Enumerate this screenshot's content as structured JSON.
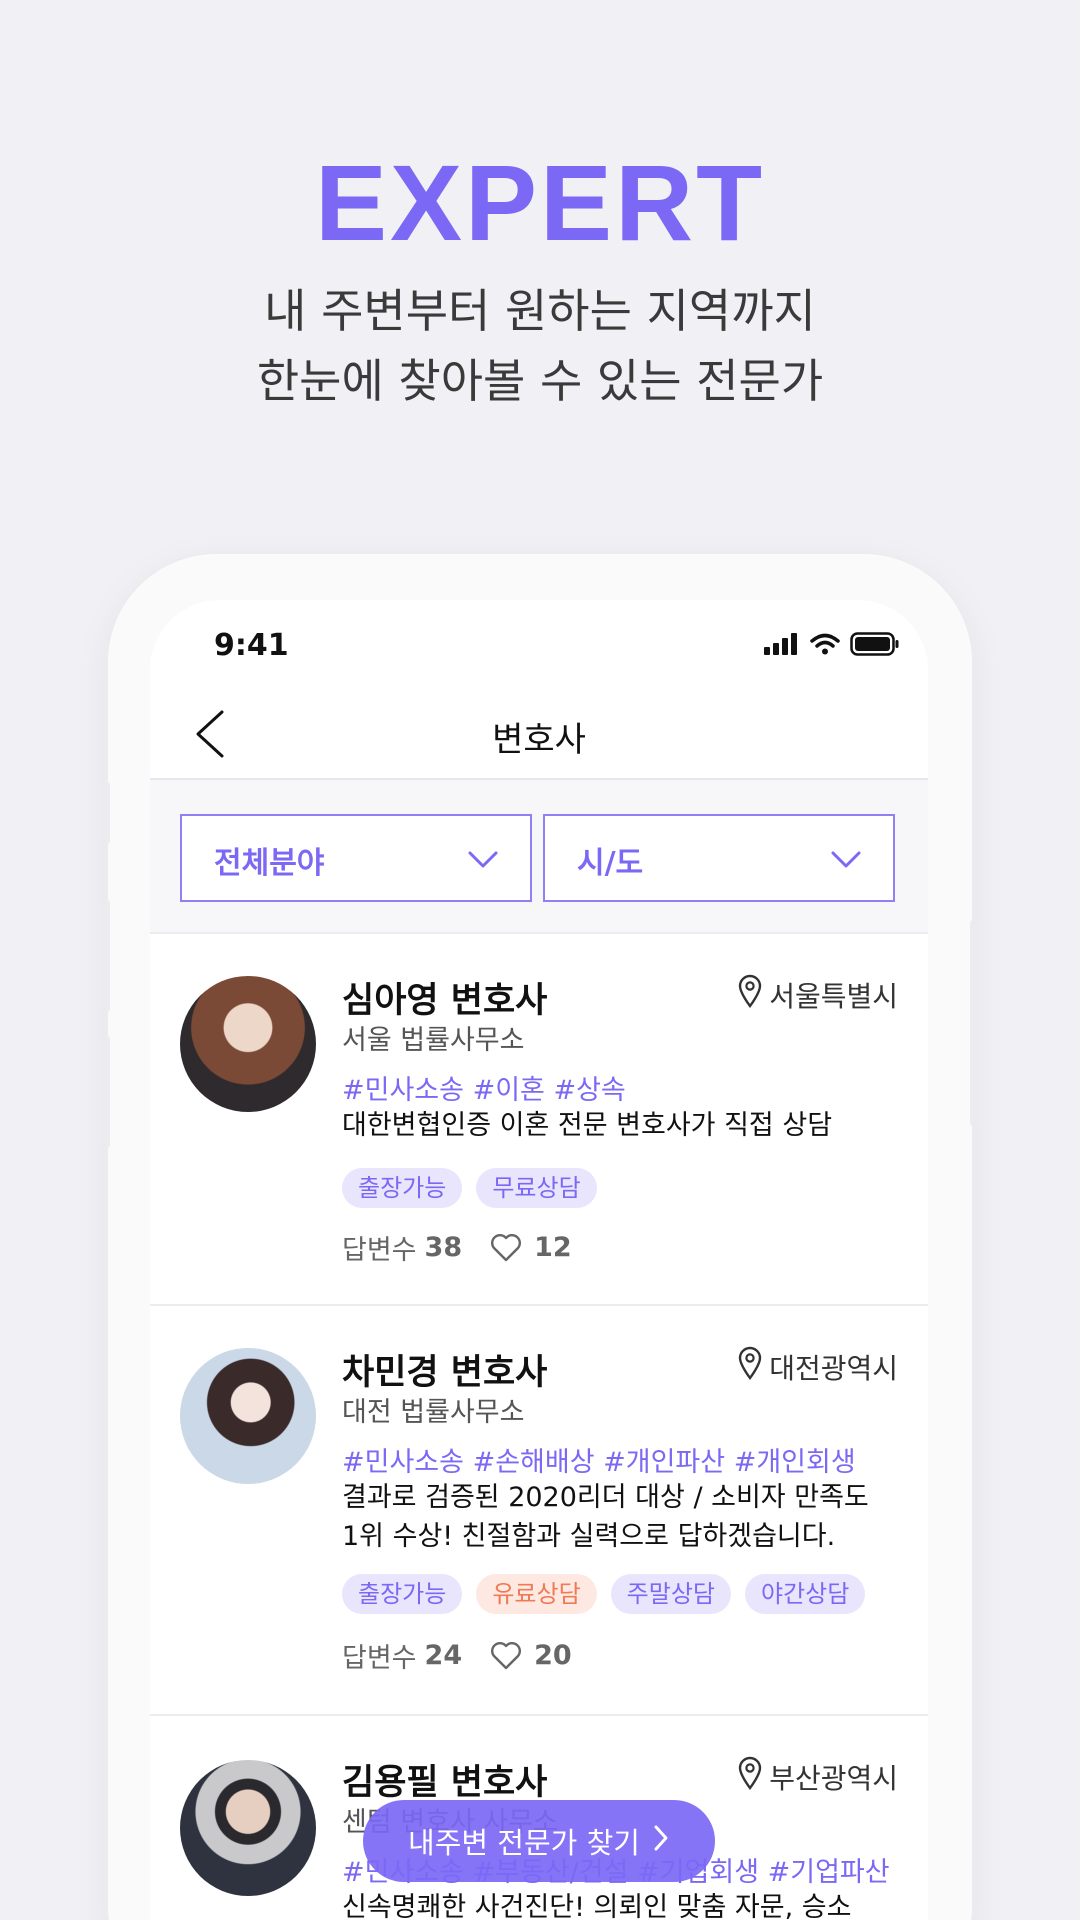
{
  "hero": {
    "title": "EXPERT",
    "subtitle_line1": "내 주변부터 원하는 지역까지",
    "subtitle_line2": "한눈에 찾아볼 수 있는 전문가"
  },
  "status_bar": {
    "time": "9:41"
  },
  "nav": {
    "title": "변호사"
  },
  "filters": {
    "field": "전체분야",
    "region": "시/도"
  },
  "colors": {
    "accent": "#7b68f5",
    "badge_bg": "#e8e5fd",
    "paid_badge_bg": "#fde9e2",
    "paid_badge_text": "#f07a55"
  },
  "lawyers": [
    {
      "name": "심아영 변호사",
      "location": "서울특별시",
      "firm": "서울 법률사무소",
      "tags": "#민사소송 #이혼 #상속",
      "description": "대한변협인증 이혼 전문 변호사가 직접 상담",
      "badges": [
        "출장가능",
        "무료상담"
      ],
      "answers_label": "답변수",
      "answers": "38",
      "likes": "12"
    },
    {
      "name": "차민경 변호사",
      "location": "대전광역시",
      "firm": "대전 법률사무소",
      "tags": "#민사소송 #손해배상 #개인파산 #개인회생",
      "description_line1": "결과로 검증된 2020리더 대상 / 소비자 만족도",
      "description_line2": "1위 수상! 친절함과 실력으로 답하겠습니다.",
      "badges": [
        "출장가능",
        "유료상담",
        "주말상담",
        "야간상담"
      ],
      "answers_label": "답변수",
      "answers": "24",
      "likes": "20"
    },
    {
      "name": "김용필 변호사",
      "location": "부산광역시",
      "firm": "센텀 변호사 사무소",
      "tags": "#민사소송 #부동산/건설 #기업회생 #기업파산",
      "description": "신속명쾌한 사건진단! 의뢰인 맞춤 자문, 승소"
    }
  ],
  "fab": {
    "label": "내주변 전문가 찾기"
  }
}
